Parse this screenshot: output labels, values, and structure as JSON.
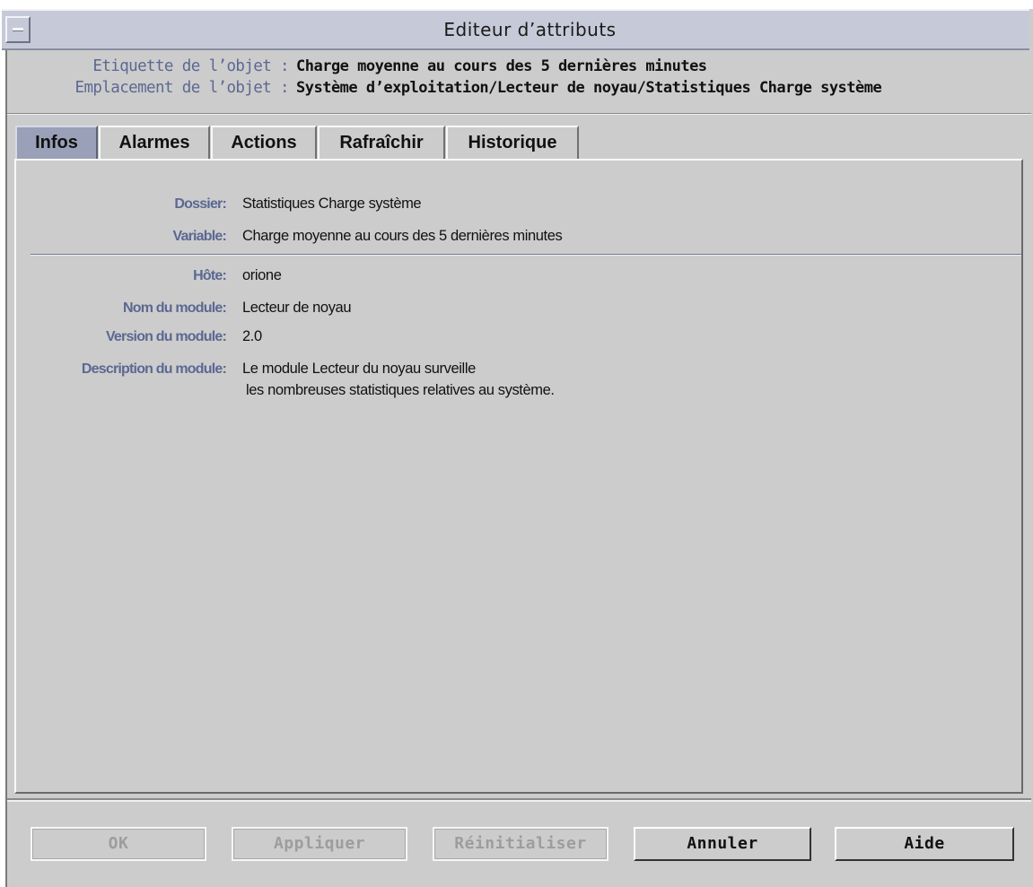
{
  "window": {
    "title": "Editeur d’attributs"
  },
  "header": {
    "object_label_caption": "Etiquette de l’objet :",
    "object_label_value": "Charge moyenne au cours des 5 dernières minutes",
    "object_location_caption": "Emplacement de l’objet :",
    "object_location_value": "Système d’exploitation/Lecteur de noyau/Statistiques Charge système"
  },
  "tabs": [
    {
      "label": "Infos",
      "active": true
    },
    {
      "label": "Alarmes",
      "active": false
    },
    {
      "label": "Actions",
      "active": false
    },
    {
      "label": "Rafraîchir",
      "active": false
    },
    {
      "label": "Historique",
      "active": false
    }
  ],
  "info": {
    "folder_label": "Dossier:",
    "folder_value": "Statistiques Charge système",
    "variable_label": "Variable:",
    "variable_value": "Charge moyenne au cours des 5 dernières minutes",
    "host_label": "Hôte:",
    "host_value": "orione",
    "module_name_label": "Nom du module:",
    "module_name_value": "Lecteur de noyau",
    "module_version_label": "Version du module:",
    "module_version_value": "2.0",
    "module_description_label": "Description du module:",
    "module_description_line1": "Le module Lecteur du noyau surveille",
    "module_description_line2": "les nombreuses statistiques relatives au système."
  },
  "buttons": {
    "ok": {
      "label": "OK",
      "enabled": false
    },
    "apply": {
      "label": "Appliquer",
      "enabled": false
    },
    "reset": {
      "label": "Réinitialiser",
      "enabled": false
    },
    "cancel": {
      "label": "Annuler",
      "enabled": true
    },
    "help": {
      "label": "Aide",
      "enabled": true
    }
  },
  "colors": {
    "window_bg": "#cccccc",
    "title_bar": "#c6cad8",
    "label_blue": "#5b6892",
    "active_tab": "#9aa0b8",
    "disabled_text": "#9d9d9d"
  }
}
